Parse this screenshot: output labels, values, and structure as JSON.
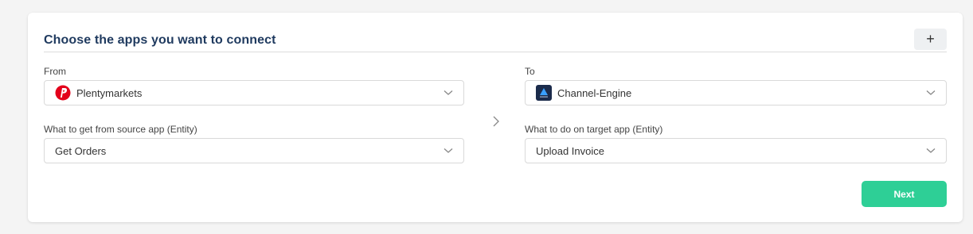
{
  "header": {
    "title": "Choose the apps you want to connect",
    "add_label": "+"
  },
  "source": {
    "from_label": "From",
    "app": {
      "name": "Plentymarkets",
      "icon": "plentymarkets-logo-icon",
      "color": "#e3001b"
    },
    "entity_label": "What to get from source app (Entity)",
    "entity": "Get Orders"
  },
  "target": {
    "to_label": "To",
    "app": {
      "name": "Channel-Engine",
      "icon": "channel-engine-logo-icon",
      "color": "#1b2b4b"
    },
    "entity_label": "What to do on target app (Entity)",
    "entity": "Upload Invoice"
  },
  "actions": {
    "next_label": "Next",
    "next_color": "#2ecf96"
  }
}
